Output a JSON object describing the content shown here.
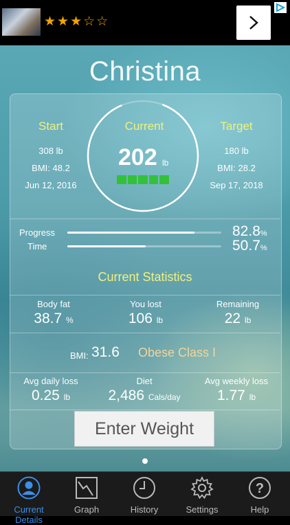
{
  "ad": {
    "stars": "★★★☆☆",
    "next_icon": "chevron-right-icon"
  },
  "profile": {
    "name": "Christina"
  },
  "start": {
    "label": "Start",
    "weight": "308 lb",
    "bmi": "BMI: 48.2",
    "date": "Jun 12, 2016"
  },
  "current": {
    "label": "Current",
    "weight": "202",
    "unit": "lb"
  },
  "target": {
    "label": "Target",
    "weight": "180 lb",
    "bmi": "BMI: 28.2",
    "date": "Sep 17, 2018"
  },
  "progress": {
    "label": "Progress",
    "value": "82.8",
    "unit": "%",
    "fraction": 0.828
  },
  "time": {
    "label": "Time",
    "value": "50.7",
    "unit": "%",
    "fraction": 0.507
  },
  "stats": {
    "title": "Current Statistics",
    "body_fat": {
      "label": "Body fat",
      "value": "38.7",
      "unit": "%"
    },
    "lost": {
      "label": "You lost",
      "value": "106",
      "unit": "lb"
    },
    "remaining": {
      "label": "Remaining",
      "value": "22",
      "unit": "lb"
    }
  },
  "bmi": {
    "label": "BMI:",
    "value": "31.6",
    "class": "Obese Class I"
  },
  "loss": {
    "daily": {
      "label": "Avg daily loss",
      "value": "0.25",
      "unit": "lb"
    },
    "diet": {
      "label": "Diet",
      "value": "2,486",
      "unit": "Cals/day"
    },
    "weekly": {
      "label": "Avg weekly loss",
      "value": "1.77",
      "unit": "lb"
    }
  },
  "enter_button": "Enter Weight",
  "tabs": [
    {
      "label": "Current Details",
      "icon": "person-icon"
    },
    {
      "label": "Graph",
      "icon": "graph-icon"
    },
    {
      "label": "History",
      "icon": "clock-icon"
    },
    {
      "label": "Settings",
      "icon": "gear-icon"
    },
    {
      "label": "Help",
      "icon": "help-icon"
    }
  ],
  "colors": {
    "accent_yellow": "#f1f27c",
    "progress_green": "#33c13a",
    "active_tab": "#3b8fe8"
  }
}
